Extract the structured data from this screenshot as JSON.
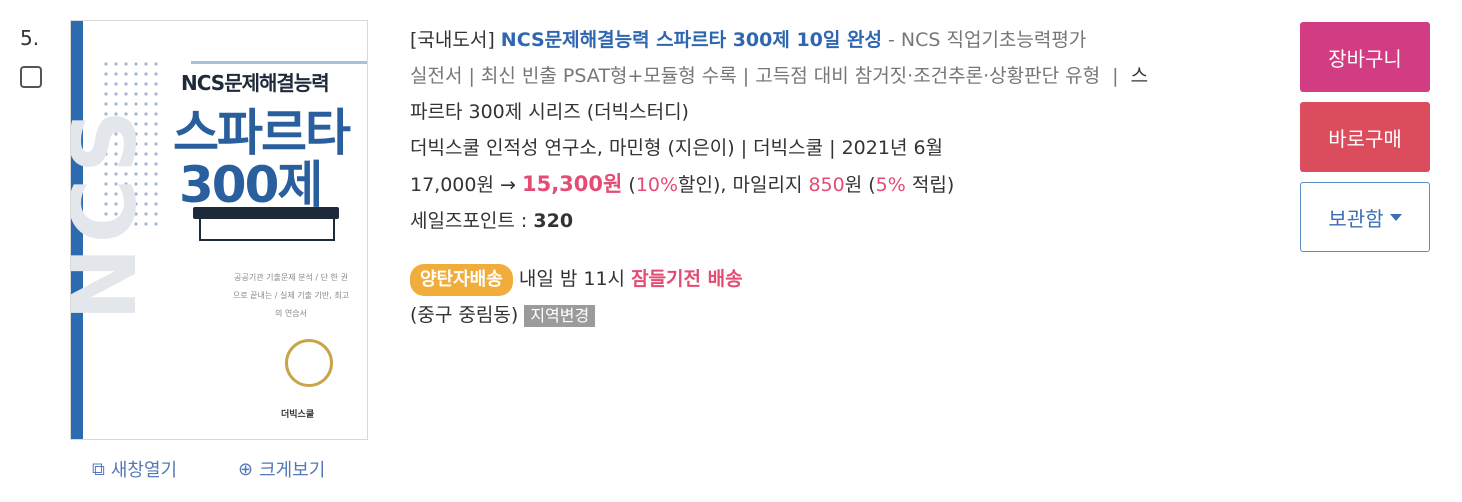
{
  "item": {
    "rank": "5.",
    "category": "[국내도서]",
    "title": "NCS문제해결능력 스파르타 300제 10일 완성",
    "subtitle_part1": "- NCS 직업기초능력평가",
    "subtitle_part2": "실전서 | 최신 빈출 PSAT형+모듈형 수록 | 고득점 대비 참거짓·조건추론·상황판단 유형",
    "series_sep": "|",
    "series_part1": "스",
    "series_part2": "파르타 300제 시리즈 (더빅스터디)",
    "authors": "더빅스쿨 인적성 연구소, 마민형 (지은이) | 더빅스쿨 | 2021년 6월",
    "price_original": "17,000원",
    "arrow": "→",
    "price_sale": "15,300원",
    "discount_open": "(",
    "discount_rate": "10%",
    "discount_close": "할인), 마일리지",
    "mileage_value": "850",
    "mileage_unit": "원 (",
    "mileage_rate": "5%",
    "mileage_close": "적립)",
    "sales_point_label": "세일즈포인트 :",
    "sales_point_value": "320",
    "delivery_badge": "양탄자배송",
    "delivery_time": "내일 밤 11시",
    "delivery_note": "잠들기전 배송",
    "location": "(중구 중림동)",
    "location_change": "지역변경"
  },
  "cover": {
    "line1": "NCS문제해결능력",
    "line2": "스파르타",
    "line3": "300제",
    "vertical": "NCS",
    "blurb": "공공기관 기출문제 분석 / 단 한 권으로 끝내는 / 실제 기출 기반, 최고의 연습서",
    "publisher": "더빅스쿨"
  },
  "links": {
    "new_window": "새창열기",
    "zoom": "크게보기"
  },
  "buttons": {
    "cart": "장바구니",
    "buy_now": "바로구매",
    "keep": "보관함"
  },
  "colors": {
    "title": "#2f66b0",
    "sale": "#e44c74",
    "cart": "#d23c83",
    "buy": "#db4d5d",
    "badge": "#f1ad3c"
  }
}
